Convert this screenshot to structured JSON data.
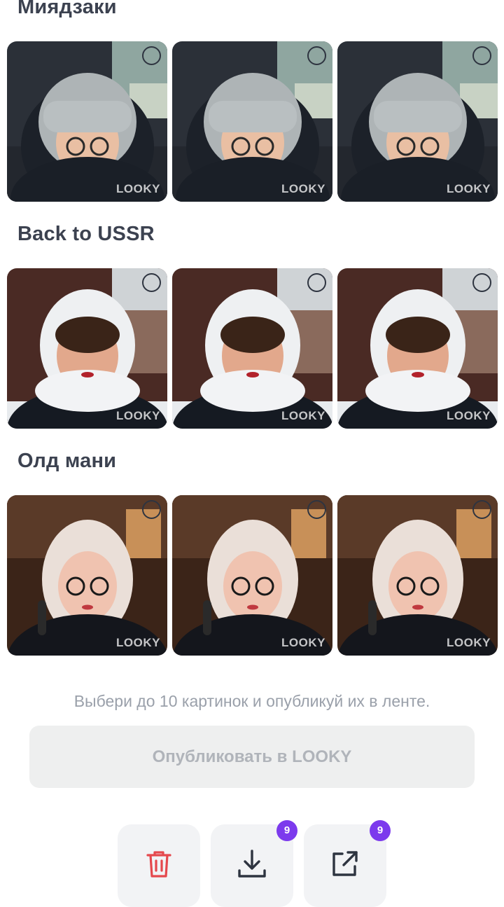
{
  "sections": [
    {
      "title": "Миядзаки"
    },
    {
      "title": "Back to USSR"
    },
    {
      "title": "Олд мани"
    }
  ],
  "watermark": "LOOKY",
  "hint": "Выбери до 10 картинок и опубликуй их в ленте.",
  "publish_label": "Опубликовать в LOOKY",
  "actions": {
    "download_badge": "9",
    "share_badge": "9"
  },
  "colors": {
    "accent_badge": "#7c3aed",
    "delete_icon": "#e5484d",
    "icon_dark": "#2e3440"
  },
  "icons": [
    "select-circle",
    "trash-icon",
    "download-icon",
    "share-icon"
  ]
}
